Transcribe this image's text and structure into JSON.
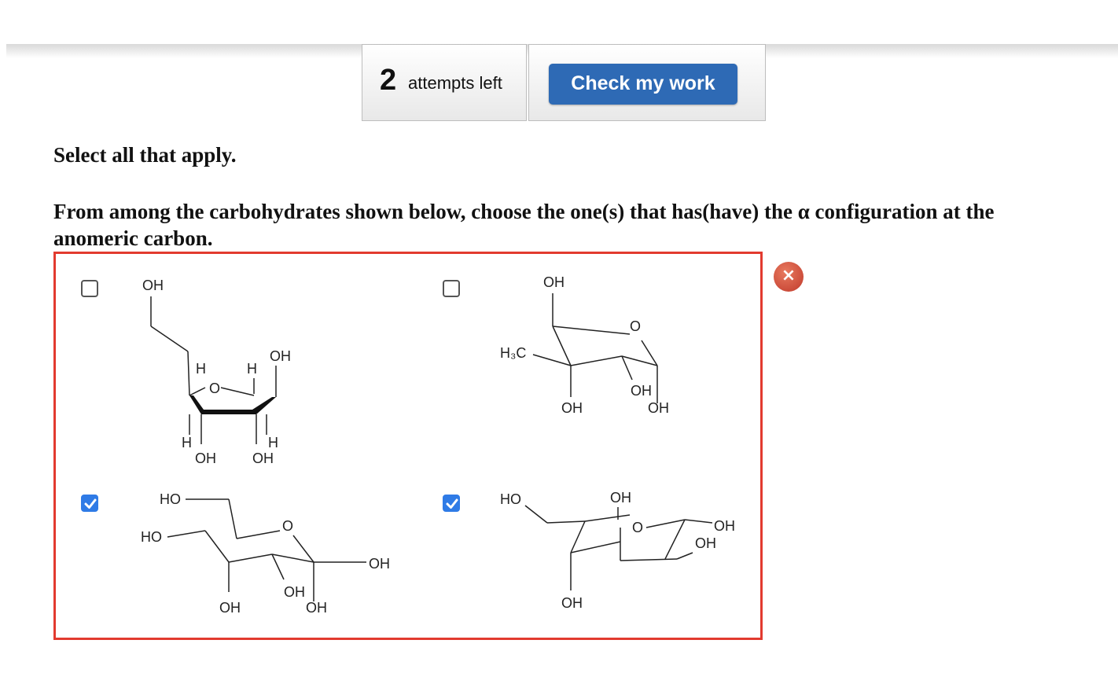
{
  "attempts": {
    "count": "2",
    "label": "attempts left"
  },
  "check_button": {
    "label": "Check my work"
  },
  "instruction": "Select all that apply.",
  "question": "From among the carbohydrates shown below, choose the one(s) that has(have) the α configuration at the anomeric carbon.",
  "status_icon": {
    "glyph": "×",
    "meaning": "incorrect"
  },
  "options": [
    {
      "checked": false,
      "labels": {
        "oh_top": "OH",
        "h1": "H",
        "h2": "H",
        "oh_right": "OH",
        "o": "O",
        "h3": "H",
        "h4": "H",
        "oh_b1": "OH",
        "oh_b2": "OH"
      }
    },
    {
      "checked": false,
      "labels": {
        "oh_top": "OH",
        "o": "O",
        "h3c": "H₃C",
        "oh_mid": "OH",
        "oh_b1": "OH",
        "oh_b2": "OH"
      }
    },
    {
      "checked": true,
      "labels": {
        "ho1": "HO",
        "ho2": "HO",
        "o": "O",
        "oh_right": "OH",
        "oh_mid": "OH",
        "oh_b1": "OH",
        "oh_b2": "OH"
      }
    },
    {
      "checked": true,
      "labels": {
        "ho": "HO",
        "oh_top": "OH",
        "o": "O",
        "oh_r1": "OH",
        "oh_r2": "OH",
        "oh_b": "OH"
      }
    }
  ],
  "colors": {
    "accent": "#2e6ab5",
    "error": "#e23a2f",
    "checkbox_checked": "#2f7be6"
  }
}
